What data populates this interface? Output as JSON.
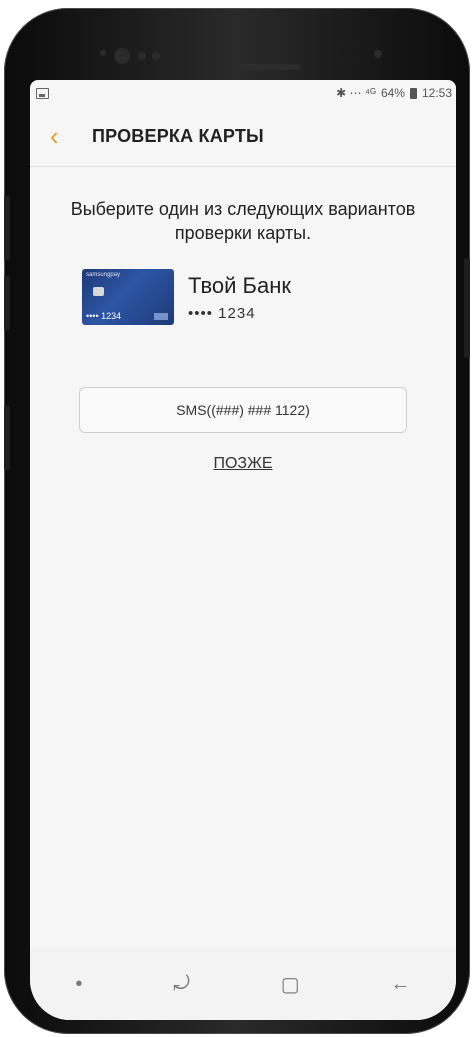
{
  "status": {
    "icons": "✱ ⋯ ⁴ᴳ",
    "battery": "64%",
    "time": "12:53"
  },
  "appbar": {
    "title": "ПРОВЕРКА КАРТЫ"
  },
  "content": {
    "instruction": "Выберите один из следующих вариантов проверки карты.",
    "card": {
      "brand": "samsungpay",
      "bank_name": "Твой Банк",
      "masked_number": "•••• 1234",
      "thumb_number": "•••• 1234"
    },
    "sms_button_label": "SMS((###) ### 1122)",
    "later_link": "ПОЗЖЕ"
  },
  "navbar": {
    "dot": "•",
    "recent": "⤾",
    "home": "▢",
    "back": "←"
  }
}
